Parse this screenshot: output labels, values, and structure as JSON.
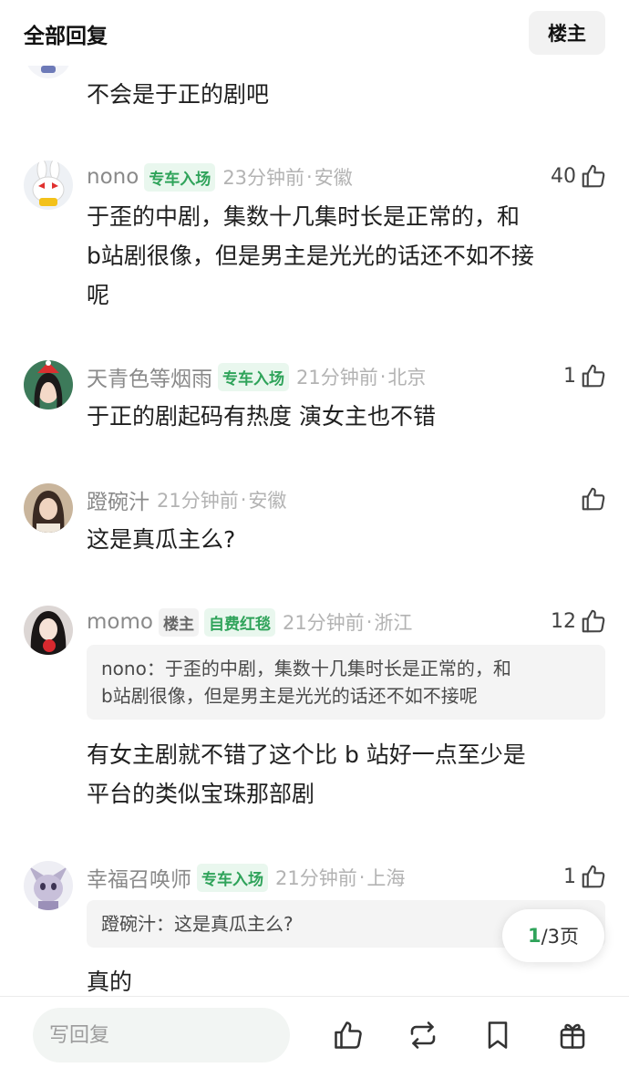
{
  "header": {
    "title": "全部回复",
    "op_filter_label": "楼主"
  },
  "partial_comment": {
    "text": "不会是于正的剧吧"
  },
  "comments": [
    {
      "username": "nono",
      "badges": [
        "专车入场"
      ],
      "time": "23分钟前",
      "location": "安徽",
      "likes": "40",
      "text_lines": [
        "于歪的中剧，集数十几集时长是正常的，和",
        "b站剧很像，但是男主是光光的话还不如不接",
        "呢"
      ]
    },
    {
      "username": "天青色等烟雨",
      "badges": [
        "专车入场"
      ],
      "time": "21分钟前",
      "location": "北京",
      "likes": "1",
      "text_lines": [
        "于正的剧起码有热度 演女主也不错"
      ]
    },
    {
      "username": "蹬碗汁",
      "badges": [],
      "time": "21分钟前",
      "location": "安徽",
      "likes": "",
      "text_lines": [
        "这是真瓜主么?"
      ]
    },
    {
      "username": "momo",
      "badges": [
        "楼主",
        "自费红毯"
      ],
      "time": "21分钟前",
      "location": "浙江",
      "likes": "12",
      "quote_lines": [
        "nono：于歪的中剧，集数十几集时长是正常的，和",
        "b站剧很像，但是男主是光光的话还不如不接呢"
      ],
      "text_lines": [
        "有女主剧就不错了这个比 b 站好一点至少是",
        "平台的类似宝珠那部剧"
      ]
    },
    {
      "username": "幸福召唤师",
      "badges": [
        "专车入场"
      ],
      "time": "21分钟前",
      "location": "上海",
      "likes": "1",
      "quote_lines": [
        "蹬碗汁：这是真瓜主么?"
      ],
      "text_lines": [
        "真的"
      ]
    }
  ],
  "pagination": {
    "current": "1",
    "total": "/3页"
  },
  "bottom_bar": {
    "reply_placeholder": "写回复",
    "icons": [
      "thumbs-up-icon",
      "repost-icon",
      "bookmark-icon",
      "gift-icon"
    ]
  },
  "colors": {
    "accent_green": "#2fa35a",
    "badge_bg": "#e9f7ee",
    "muted_text": "#8a8a8a"
  }
}
